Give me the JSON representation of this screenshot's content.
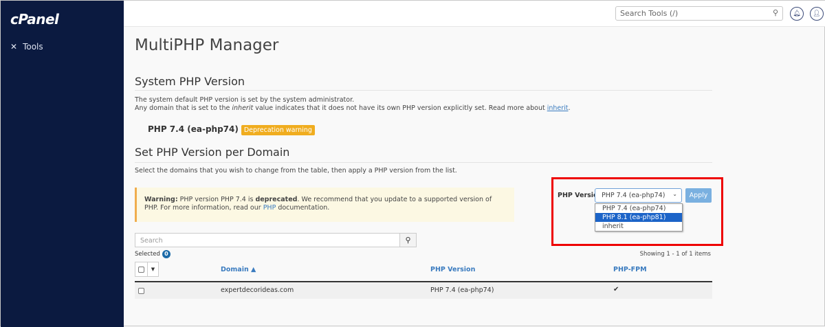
{
  "sidebar": {
    "logo": "cPanel",
    "items": [
      {
        "label": "Tools",
        "icon": "tools-icon"
      }
    ]
  },
  "header": {
    "search_placeholder": "Search Tools (/)",
    "icons": [
      "search-icon",
      "bell-icon",
      "user-icon"
    ]
  },
  "page": {
    "title": "MultiPHP Manager"
  },
  "system": {
    "heading": "System PHP Version",
    "line1": "The system default PHP version is set by the system administrator.",
    "line2_a": "Any domain that is set to the ",
    "line2_em": "inherit",
    "line2_b": " value indicates that it does not have its own PHP version explicitly set. Read more about ",
    "line2_link": "inherit",
    "line2_end": ".",
    "version": "PHP 7.4 (ea-php74)",
    "badge": "Deprecation warning",
    "badge_color": "#f0ad1f"
  },
  "domain_section": {
    "heading": "Set PHP Version per Domain",
    "intro": "Select the domains that you wish to change from the table, then apply a PHP version from the list.",
    "warning": {
      "label": "Warning:",
      "a": " PHP version PHP 7.4 is ",
      "bold": "deprecated",
      "b": ". We recommend that you update to a supported version of PHP. For more information, read our ",
      "link": "PHP",
      "c": " documentation."
    },
    "php_version_label": "PHP Version",
    "selected": "PHP 7.4 (ea-php74)",
    "options": [
      "PHP 7.4 (ea-php74)",
      "PHP 8.1 (ea-php81)",
      "inherit"
    ],
    "highlighted_option": "PHP 8.1 (ea-php81)",
    "apply": "Apply",
    "search_placeholder": "Search",
    "selected_label": "Selected",
    "selected_count": "0",
    "showing": "Showing 1 - 1 of 1 items",
    "columns": [
      "Domain ▲",
      "PHP Version",
      "PHP-FPM"
    ],
    "rows": [
      {
        "domain": "expertdecorideas.com",
        "php": "PHP 7.4 (ea-php74)",
        "fpm": "✔"
      }
    ]
  }
}
